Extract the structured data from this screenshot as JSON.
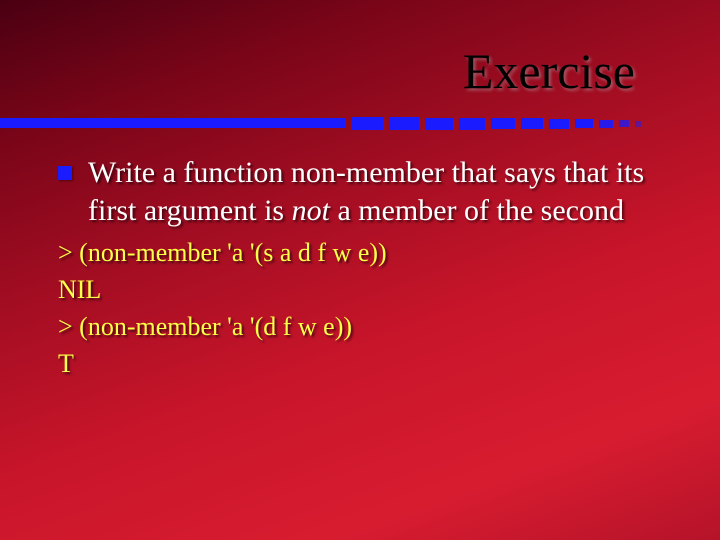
{
  "title": "Exercise",
  "bullet": {
    "pre": "Write a function non-member that says that its first argument is ",
    "emph": "not",
    "post": " a member of the second"
  },
  "code": {
    "l1": "> (non-member 'a '(s a d f w e))",
    "l2": "NIL",
    "l3": "> (non-member 'a '(d f w e))",
    "l4": "T"
  }
}
